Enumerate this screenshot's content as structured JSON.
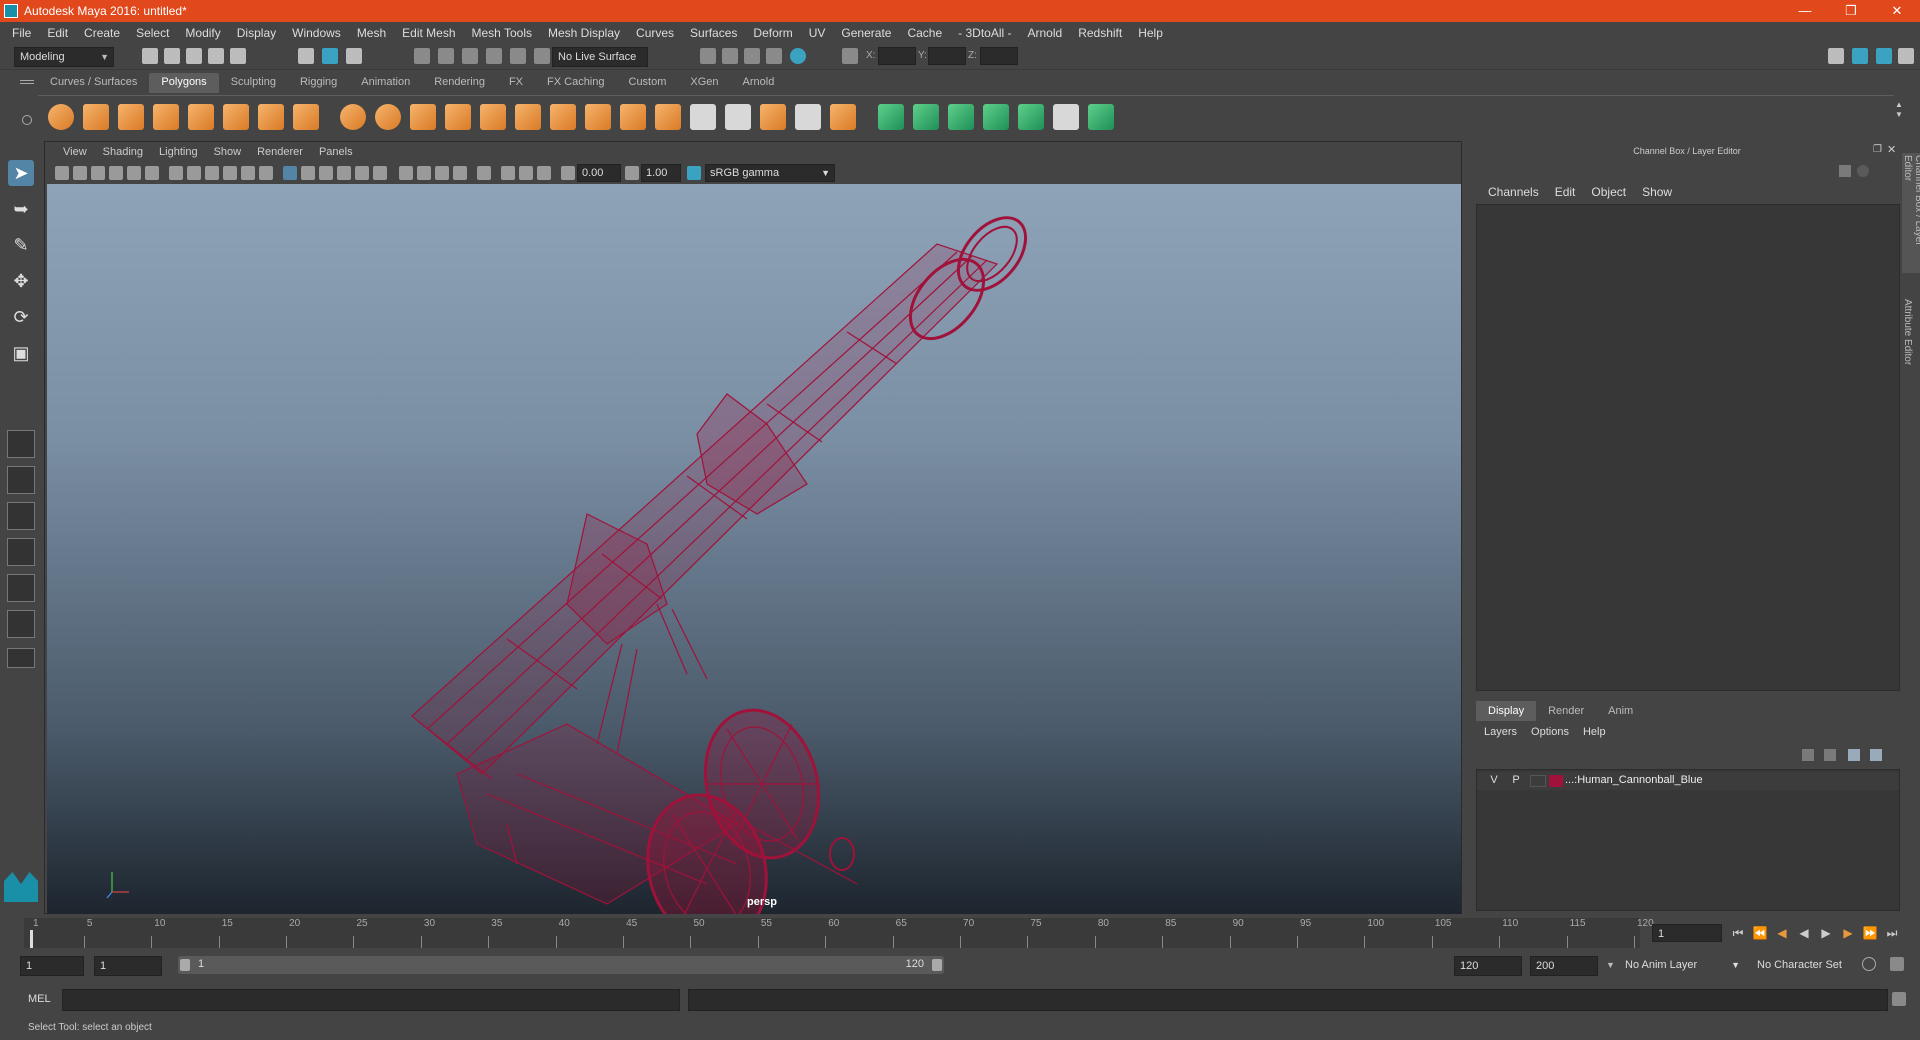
{
  "window": {
    "title": "Autodesk Maya 2016: untitled*"
  },
  "menubar": [
    "File",
    "Edit",
    "Create",
    "Select",
    "Modify",
    "Display",
    "Windows",
    "Mesh",
    "Edit Mesh",
    "Mesh Tools",
    "Mesh Display",
    "Curves",
    "Surfaces",
    "Deform",
    "UV",
    "Generate",
    "Cache",
    "- 3DtoAll -",
    "Arnold",
    "Redshift",
    "Help"
  ],
  "statusline": {
    "mode": "Modeling",
    "live_surface": "No Live Surface",
    "x_label": "X:",
    "y_label": "Y:",
    "z_label": "Z:"
  },
  "shelf_tabs": [
    "Curves / Surfaces",
    "Polygons",
    "Sculpting",
    "Rigging",
    "Animation",
    "Rendering",
    "FX",
    "FX Caching",
    "Custom",
    "XGen",
    "Arnold"
  ],
  "shelf_active": "Polygons",
  "viewport": {
    "menu": [
      "View",
      "Shading",
      "Lighting",
      "Show",
      "Renderer",
      "Panels"
    ],
    "exposure": "0.00",
    "gamma": "1.00",
    "color_space": "sRGB gamma",
    "camera_label": "persp",
    "wire_color": "#a0123a"
  },
  "channel_box": {
    "title": "Channel Box / Layer Editor",
    "menu": [
      "Channels",
      "Edit",
      "Object",
      "Show"
    ],
    "side_tabs": [
      "Channel Box / Layer Editor",
      "Attribute Editor"
    ]
  },
  "layer_editor": {
    "tabs": [
      "Display",
      "Render",
      "Anim"
    ],
    "active_tab": "Display",
    "menu": [
      "Layers",
      "Options",
      "Help"
    ],
    "layers": [
      {
        "v": "V",
        "p": "P",
        "name": "...:Human_Cannonball_Blue",
        "color": "#a0123a"
      }
    ]
  },
  "timeline": {
    "ticks": [
      "1",
      "5",
      "10",
      "15",
      "20",
      "25",
      "30",
      "35",
      "40",
      "45",
      "50",
      "55",
      "60",
      "65",
      "70",
      "75",
      "80",
      "85",
      "90",
      "95",
      "100",
      "105",
      "110",
      "115",
      "120"
    ],
    "current_frame": "1"
  },
  "range": {
    "start": "1",
    "playback_start": "1",
    "slider_start": "1",
    "slider_end": "120",
    "playback_end": "120",
    "end": "200",
    "anim_layer": "No Anim Layer",
    "character_set": "No Character Set"
  },
  "command_line": {
    "label": "MEL"
  },
  "help_line": "Select Tool: select an object"
}
